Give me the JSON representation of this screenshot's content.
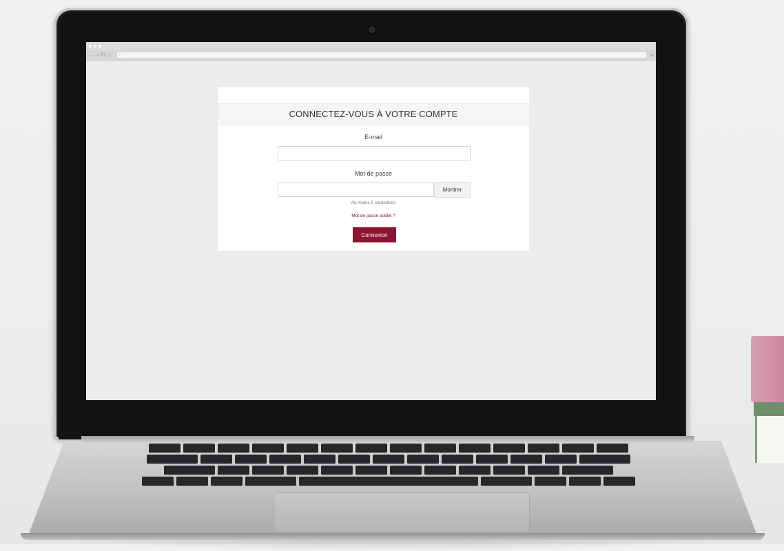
{
  "login": {
    "title": "CONNECTEZ-VOUS À VOTRE COMPTE",
    "email_label": "E-mail",
    "email_value": "",
    "password_label": "Mot de passe",
    "password_value": "",
    "show_button": "Montrer",
    "password_hint": "Au moins 5 caractères",
    "forgot_link": "Mot de passe oublié ?",
    "submit_button": "Connexion"
  },
  "browser": {
    "nav_icons": [
      "back-arrow-icon",
      "forward-arrow-icon",
      "reload-icon",
      "home-icon"
    ],
    "address_value": ""
  },
  "colors": {
    "accent": "#8c1530",
    "card_background": "#ffffff",
    "page_background": "#ececec"
  }
}
